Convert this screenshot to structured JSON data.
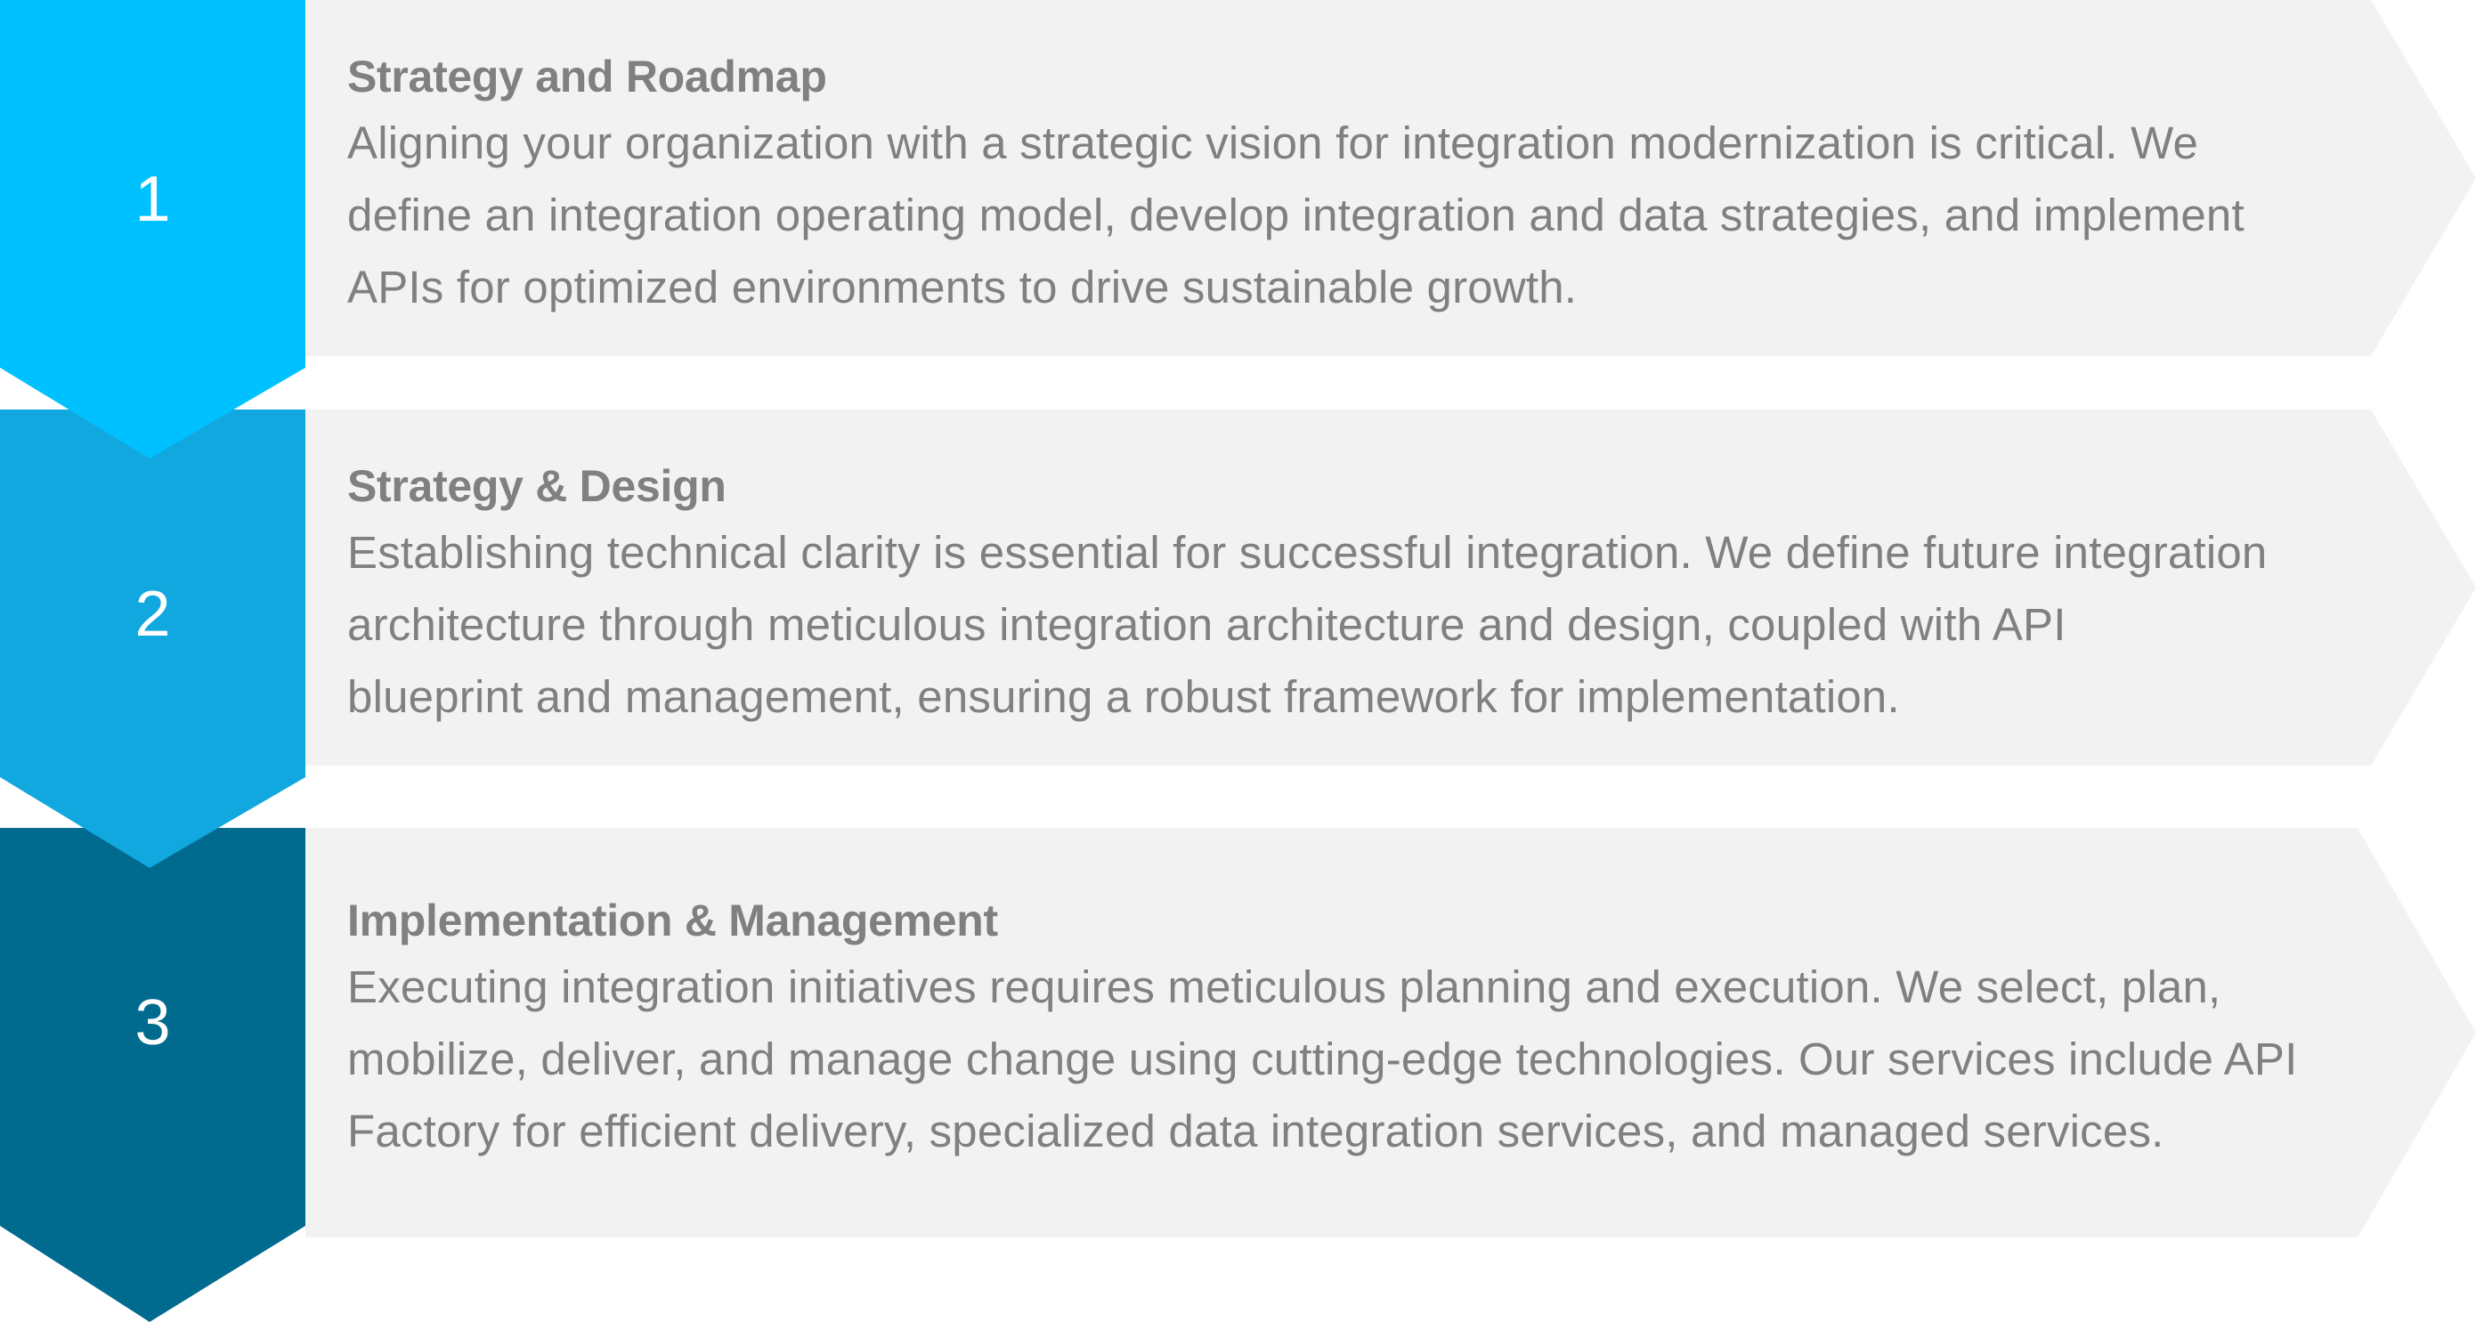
{
  "colors": {
    "step1": "#00C1FF",
    "step2": "#11A8E0",
    "step3": "#016A8F",
    "panel": "#F2F2F2",
    "text": "#808080",
    "number": "#FFFFFF"
  },
  "steps": [
    {
      "number": "1",
      "title": "Strategy and Roadmap",
      "description": "Aligning your organization with a strategic vision for integration modernization is critical. We\ndefine an integration operating model, develop integration and data strategies, and implement\nAPIs for optimized environments to drive sustainable growth."
    },
    {
      "number": "2",
      "title": "Strategy & Design",
      "description": "Establishing technical clarity is essential for successful integration. We define future integration\narchitecture through meticulous integration architecture and design, coupled with API\nblueprint and management, ensuring a robust framework for implementation."
    },
    {
      "number": "3",
      "title": "Implementation & Management",
      "description": "Executing integration initiatives requires meticulous planning and execution. We select, plan,\nmobilize, deliver, and manage change using cutting-edge technologies. Our services include API\nFactory for efficient delivery, specialized data integration services, and managed services."
    }
  ]
}
